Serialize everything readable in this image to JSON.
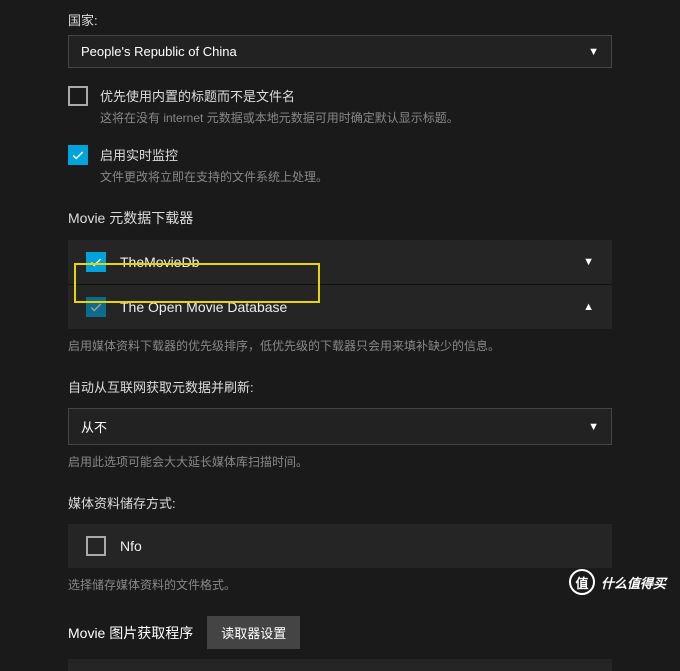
{
  "country": {
    "label": "国家:",
    "value": "People's Republic of China"
  },
  "options": {
    "preferEmbedded": {
      "title": "优先使用内置的标题而不是文件名",
      "desc": "这将在没有 internet 元数据或本地元数据可用时确定默认显示标题。",
      "checked": false
    },
    "realtimeMonitor": {
      "title": "启用实时监控",
      "desc": "文件更改将立即在支持的文件系统上处理。",
      "checked": true
    }
  },
  "downloaders": {
    "title": "Movie 元数据下载器",
    "items": [
      {
        "label": "TheMovieDb",
        "checked": true,
        "expanded": false
      },
      {
        "label": "The Open Movie Database",
        "checked": true,
        "expanded": true,
        "dim": true
      }
    ],
    "hint": "启用媒体资料下载器的优先级排序，低优先级的下载器只会用来填补缺少的信息。"
  },
  "refresh": {
    "label": "自动从互联网获取元数据并刷新:",
    "value": "从不",
    "hint": "启用此选项可能会大大延长媒体库扫描时间。"
  },
  "storage": {
    "label": "媒体资料储存方式:",
    "items": [
      {
        "label": "Nfo",
        "checked": false
      }
    ],
    "hint": "选择储存媒体资料的文件格式。"
  },
  "imageFetcher": {
    "title": "Movie 图片获取程序",
    "button": "读取器设置"
  },
  "watermark": {
    "badge": "值",
    "text": "什么值得买"
  }
}
